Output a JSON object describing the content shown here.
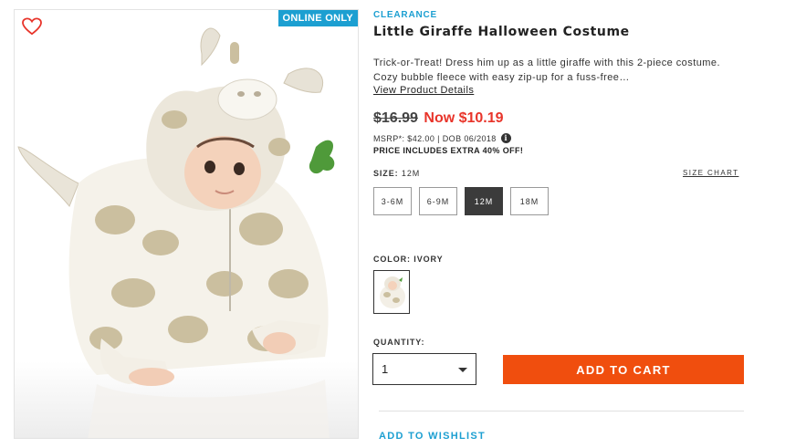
{
  "product": {
    "badge": "ONLINE ONLY",
    "image_alt_icon": "product-photo-giraffe-costume",
    "wishlist_icon": "heart-icon",
    "tag": "CLEARANCE",
    "title": "Little Giraffe Halloween Costume",
    "description": "Trick-or-Treat! Dress him up as a little giraffe with this 2-piece costume. Cozy bubble fleece with easy zip-up for a fuss-free…",
    "view_details": "View Product Details"
  },
  "pricing": {
    "original": "$16.99",
    "now": "Now $10.19",
    "msrp_line": "MSRP*: $42.00 | DOB 06/2018",
    "info_icon": "i",
    "extra_off": "PRICE INCLUDES EXTRA 40% OFF!"
  },
  "size": {
    "label": "SIZE:",
    "selected": "12M",
    "chart_link": "SIZE CHART",
    "options": [
      "3-6M",
      "6-9M",
      "12M",
      "18M"
    ]
  },
  "color": {
    "label": "COLOR: IVORY"
  },
  "quantity": {
    "label": "QUANTITY:",
    "value": "1"
  },
  "actions": {
    "add_to_cart": "ADD TO CART",
    "add_to_wishlist": "ADD TO WISHLIST"
  },
  "colors": {
    "accent_blue": "#1c9fd1",
    "sale_red": "#e8342a",
    "cta_orange": "#f04e0e",
    "selected_size": "#3b3b3b"
  }
}
